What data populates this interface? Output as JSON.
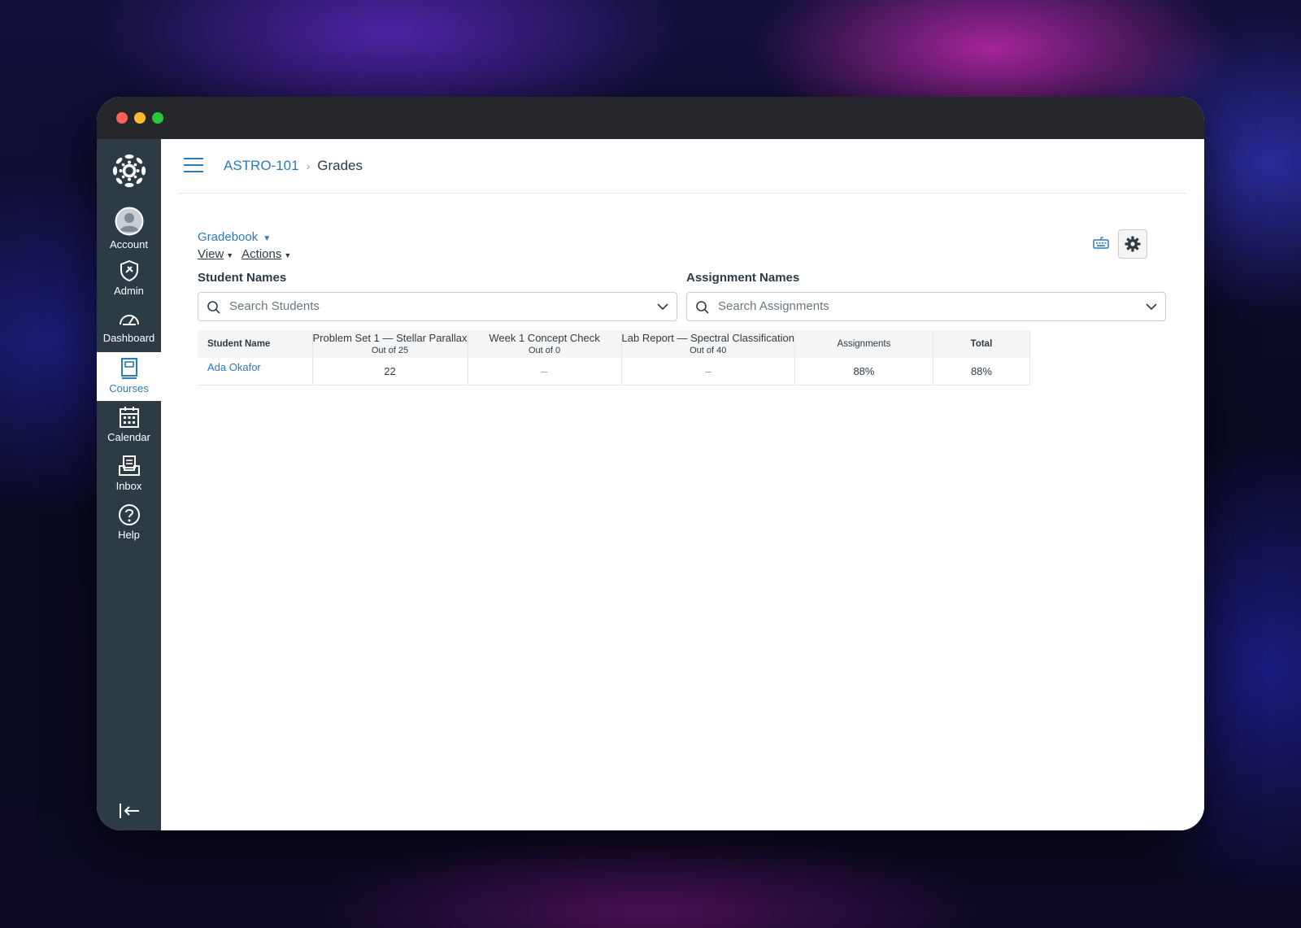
{
  "breadcrumb": {
    "course": "ASTRO-101",
    "current": "Grades"
  },
  "nav": {
    "items": [
      {
        "label": "Account",
        "icon": "account-avatar-icon"
      },
      {
        "label": "Admin",
        "icon": "shield-icon"
      },
      {
        "label": "Dashboard",
        "icon": "speedometer-icon"
      },
      {
        "label": "Courses",
        "icon": "book-icon",
        "active": true
      },
      {
        "label": "Calendar",
        "icon": "calendar-icon"
      },
      {
        "label": "Inbox",
        "icon": "inbox-icon"
      },
      {
        "label": "Help",
        "icon": "help-icon"
      }
    ]
  },
  "toolbar": {
    "gradebook_label": "Gradebook",
    "view_label": "View",
    "actions_label": "Actions"
  },
  "filters": {
    "students_label": "Student Names",
    "students_placeholder": "Search Students",
    "assignments_label": "Assignment Names",
    "assignments_placeholder": "Search Assignments"
  },
  "grid": {
    "student_header": "Student Name",
    "assignments": [
      {
        "name": "Problem Set 1 — Stellar Parallax",
        "out_of": "Out of 25"
      },
      {
        "name": "Week 1 Concept Check",
        "out_of": "Out of 0"
      },
      {
        "name": "Lab Report — Spectral Classification",
        "out_of": "Out of 40"
      }
    ],
    "group_header": "Assignments",
    "total_header": "Total",
    "rows": [
      {
        "student": "Ada Okafor",
        "scores": [
          "22",
          "–",
          "–"
        ],
        "group": "88%",
        "total": "88%"
      }
    ]
  },
  "colors": {
    "link": "#2b7abc",
    "rail": "#2d3b45",
    "text": "#2d3b45"
  }
}
